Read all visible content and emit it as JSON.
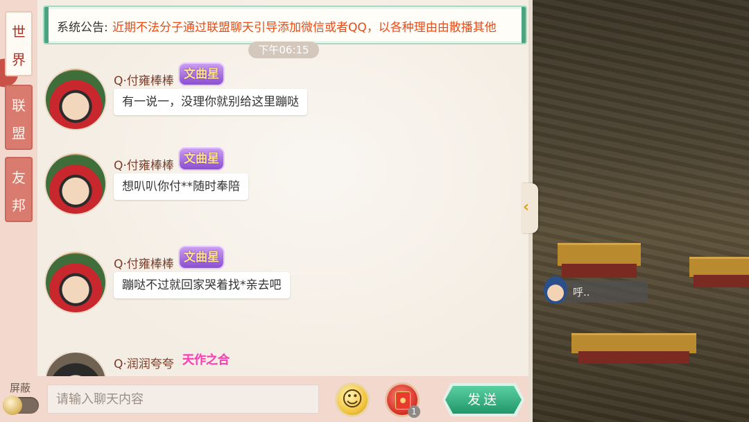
{
  "tabs": [
    {
      "label": "世界",
      "active": true
    },
    {
      "label": "联盟",
      "active": false
    },
    {
      "label": "友邦",
      "active": false
    }
  ],
  "announcement": {
    "label": "系统公告:",
    "text": "近期不法分子通过联盟聊天引导添加微信或者QQ，以各种理由由散播其他"
  },
  "timestamp": "下午06:15",
  "messages": [
    {
      "name": "Q·付雍棒棒",
      "title": "文曲星",
      "text": "有一说一，没理你就别给这里蹦哒"
    },
    {
      "name": "Q·付雍棒棒",
      "title": "文曲星",
      "text": "想叭叭你付**随时奉陪"
    },
    {
      "name": "Q·付雍棒棒",
      "title": "文曲星",
      "text": "蹦哒不过就回家哭着找*亲去吧"
    },
    {
      "name": "Q·润润夸夸",
      "title": "天作之合",
      "text": ""
    }
  ],
  "bottom": {
    "block_label": "屏蔽",
    "input_placeholder": "请输入聊天内容",
    "emoji_glyph": "☺",
    "redpacket_count": "1",
    "send_label": "发送"
  },
  "scene": {
    "bubble_text": "呼.."
  },
  "colors": {
    "accent_red": "#d97c6f",
    "announcement_text": "#e84b18",
    "send_green": "#21966a"
  }
}
